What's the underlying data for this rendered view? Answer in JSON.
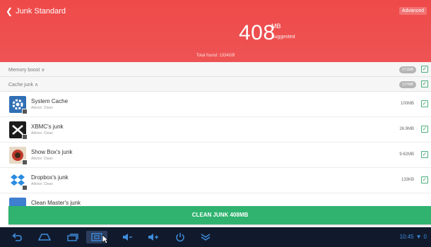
{
  "header": {
    "title": "Junk Standard",
    "advanced_label": "Advanced",
    "size_value": "408",
    "size_unit": "MB",
    "suggested_label": "Suggested",
    "total_found": "Total found: 1334GB"
  },
  "sections": {
    "memory_boost": {
      "label": "Memory boost",
      "size": "271MB"
    },
    "cache_junk": {
      "label": "Cache junk",
      "size": "137MB"
    }
  },
  "items": [
    {
      "name": "System Cache",
      "advice": "Advice: Clean",
      "size": "100MB"
    },
    {
      "name": "XBMC's junk",
      "advice": "Advice: Clean",
      "size": "26.9MB"
    },
    {
      "name": "Show Box's junk",
      "advice": "Advice: Clean",
      "size": "9.62MB"
    },
    {
      "name": "Dropbox's junk",
      "advice": "Advice: Clean",
      "size": "133KB"
    },
    {
      "name": "Clean Master's junk",
      "advice": "",
      "size": ""
    }
  ],
  "clean_button_label": "CLEAN JUNK 408MB",
  "status": {
    "time": "10:45",
    "signal": "0"
  },
  "colors": {
    "header": "#ef4a4a",
    "button": "#2fb36f",
    "navbar": "#111a2c",
    "nav_icon": "#3f8ddc"
  }
}
